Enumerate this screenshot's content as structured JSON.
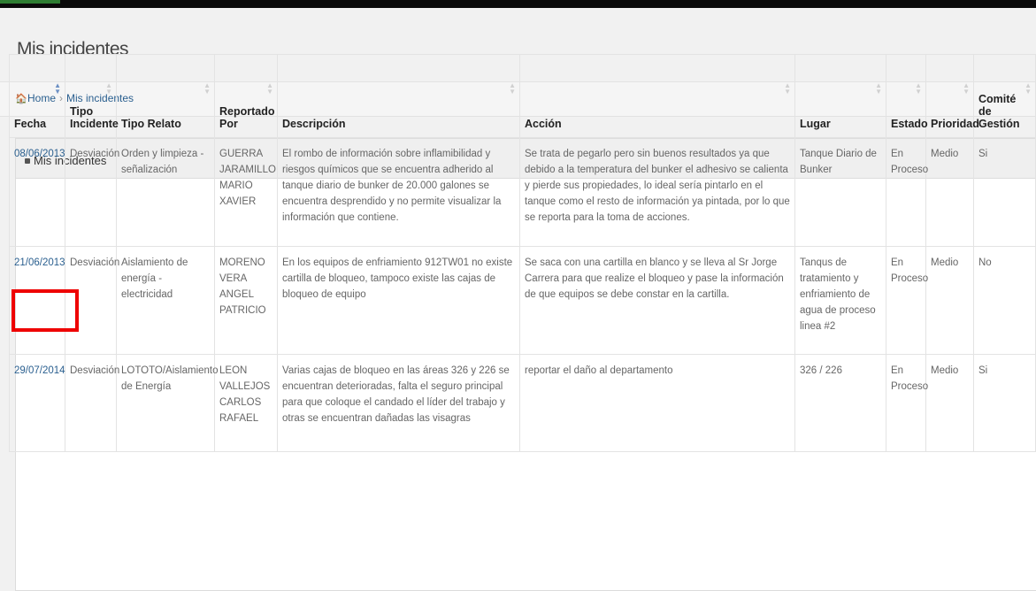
{
  "page": {
    "title": "Mis incidentes"
  },
  "breadcrumb": {
    "home": "Home",
    "current": "Mis incidentes"
  },
  "panel": {
    "title": "Mis incidentes"
  },
  "table": {
    "headers": [
      "Fecha",
      "Tipo Incidente",
      "Tipo Relato",
      "Reportado Por",
      "Descripción",
      "Acción",
      "Lugar",
      "Estado",
      "Prioridad",
      "Comité de Gestión"
    ],
    "rows": [
      {
        "fecha": "08/06/2013",
        "tipo_incidente": "Desviación",
        "tipo_relato": "Orden y limpieza - señalización",
        "reportado_por": "GUERRA JARAMILLO MARIO XAVIER",
        "descripcion": "El rombo de información sobre inflamibilidad y riesgos químicos que se encuentra adherido al tanque diario de bunker de 20.000 galones se encuentra desprendido y no permite visualizar la información que contiene.",
        "accion": "Se trata de pegarlo pero sin buenos resultados ya que debido a la temperatura del bunker el adhesivo se calienta y pierde sus propiedades, lo ideal sería pintarlo en el tanque como el resto de información ya pintada, por lo que se reporta para la toma de acciones.",
        "lugar": "Tanque Diario de Bunker",
        "estado": "En Proceso",
        "prioridad": "Medio",
        "comite": "Si"
      },
      {
        "fecha": "21/06/2013",
        "tipo_incidente": "Desviación",
        "tipo_relato": "Aislamiento de energía - electricidad",
        "reportado_por": "MORENO VERA ANGEL PATRICIO",
        "descripcion": "En los equipos de enfriamiento 912TW01 no existe cartilla de bloqueo, tampoco existe las cajas de bloqueo de equipo",
        "accion": "Se saca con una cartilla en blanco y se lleva al Sr Jorge Carrera para que realize el bloqueo y pase la información de que equipos se debe constar en la cartilla.",
        "lugar": "Tanqus de tratamiento y enfriamiento de agua de proceso linea #2",
        "estado": "En Proceso",
        "prioridad": "Medio",
        "comite": "No"
      },
      {
        "fecha": "29/07/2014",
        "tipo_incidente": "Desviación",
        "tipo_relato": "LOTOTO/Aislamiento de Energía",
        "reportado_por": "LEON VALLEJOS CARLOS RAFAEL",
        "descripcion": "Varias cajas de bloqueo en las áreas 326 y 226 se encuentran deterioradas, falta el seguro principal para que coloque el candado el líder del trabajo y otras se encuentran dañadas las visagras",
        "accion": "reportar el daño al departamento",
        "lugar": "326 / 226",
        "estado": "En Proceso",
        "prioridad": "Medio",
        "comite": "Si"
      }
    ]
  },
  "colors": {
    "link": "#2a5f8f",
    "highlight": "#e00000"
  },
  "icons": {
    "breadcrumb": "home-icon",
    "panel": "hand-pointer-icon",
    "sort": "sort-icon"
  }
}
